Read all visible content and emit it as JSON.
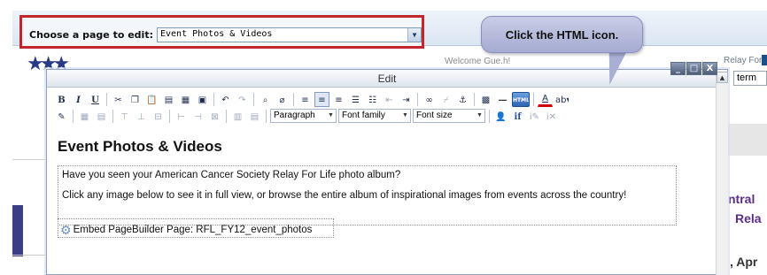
{
  "background": {
    "welcome_text": "Welcome Gue.h!",
    "relay_link": "Relay For Life on",
    "search_value": "term",
    "side_heading_1": "ntral",
    "side_heading_2": "Rela",
    "side_date": ", Apr"
  },
  "chooser": {
    "label": "Choose a page to edit:",
    "selected": "Event Photos & Videos"
  },
  "callout": {
    "text": "Click the HTML icon."
  },
  "window": {
    "title": "Edit",
    "controls": {
      "minimize": "_",
      "maximize": "□",
      "close": "X"
    }
  },
  "toolbar": {
    "paragraph_select": "Paragraph",
    "font_family_select": "Font family",
    "font_size_select": "Font size",
    "bold_label": "B",
    "italic_label": "I",
    "underline_label": "U",
    "html_label": "HTML",
    "font_color_label": "A",
    "if_label": "if"
  },
  "content": {
    "heading": "Event Photos & Videos",
    "paragraph_1": "Have you seen your American Cancer Society Relay For Life photo album?",
    "paragraph_2": "Click any image below to see it in full view, or browse the entire album of inspirational images from events across the country!",
    "embed_label": "Embed PageBuilder Page: RFL_FY12_event_photos"
  },
  "colors": {
    "highlight_border": "#c0262c",
    "callout_fill": "#b7bcdd",
    "heading_purple": "#5b2d8b"
  }
}
